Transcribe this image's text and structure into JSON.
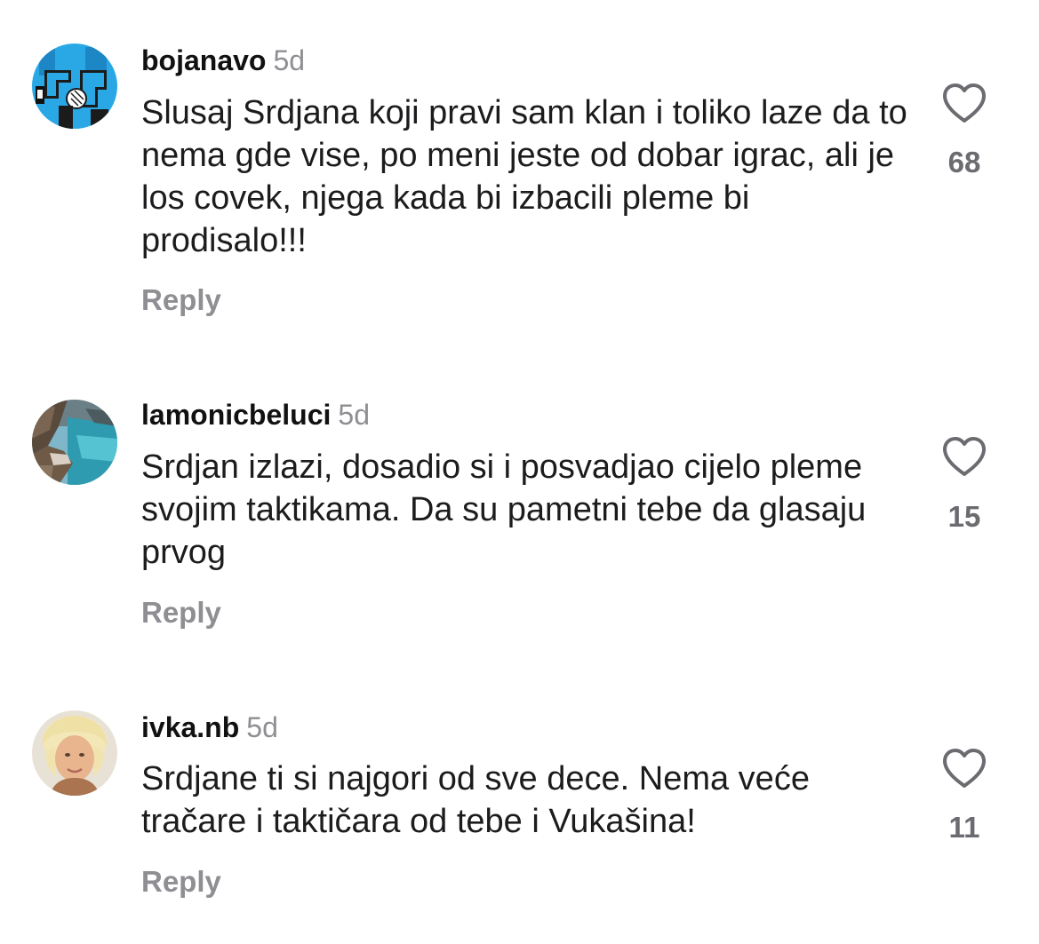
{
  "comments": [
    {
      "username": "bojanavo",
      "time": "5d",
      "text": "Slusaj Srdjana koji pravi sam klan i toliko laze da to nema gde vise, po meni jeste od dobar igrac, ali je los covek, njega kada bi izbacili pleme bi prodisalo!!!",
      "reply_label": "Reply",
      "likes": "68",
      "avatar": "blue-illustration-avatar"
    },
    {
      "username": "lamonicbeluci",
      "time": "5d",
      "text": "Srdjan izlazi, dosadio si i posvadjao cijelo pleme svojim taktikama. Da su pametni tebe da glasaju prvog",
      "reply_label": "Reply",
      "likes": "15",
      "avatar": "seaside-cliff-avatar"
    },
    {
      "username": "ivka.nb",
      "time": "5d",
      "text": "Srdjane ti si najgori od sve dece. Nema veće tračare i taktičara od tebe i Vukašina!",
      "reply_label": "Reply",
      "likes": "11",
      "avatar": "portrait-photo-avatar"
    }
  ],
  "colors": {
    "text": "#1c1c1e",
    "muted": "#8e8e93",
    "like_icon": "#6b6b70"
  },
  "icons": {
    "like": "heart-outline-icon"
  }
}
